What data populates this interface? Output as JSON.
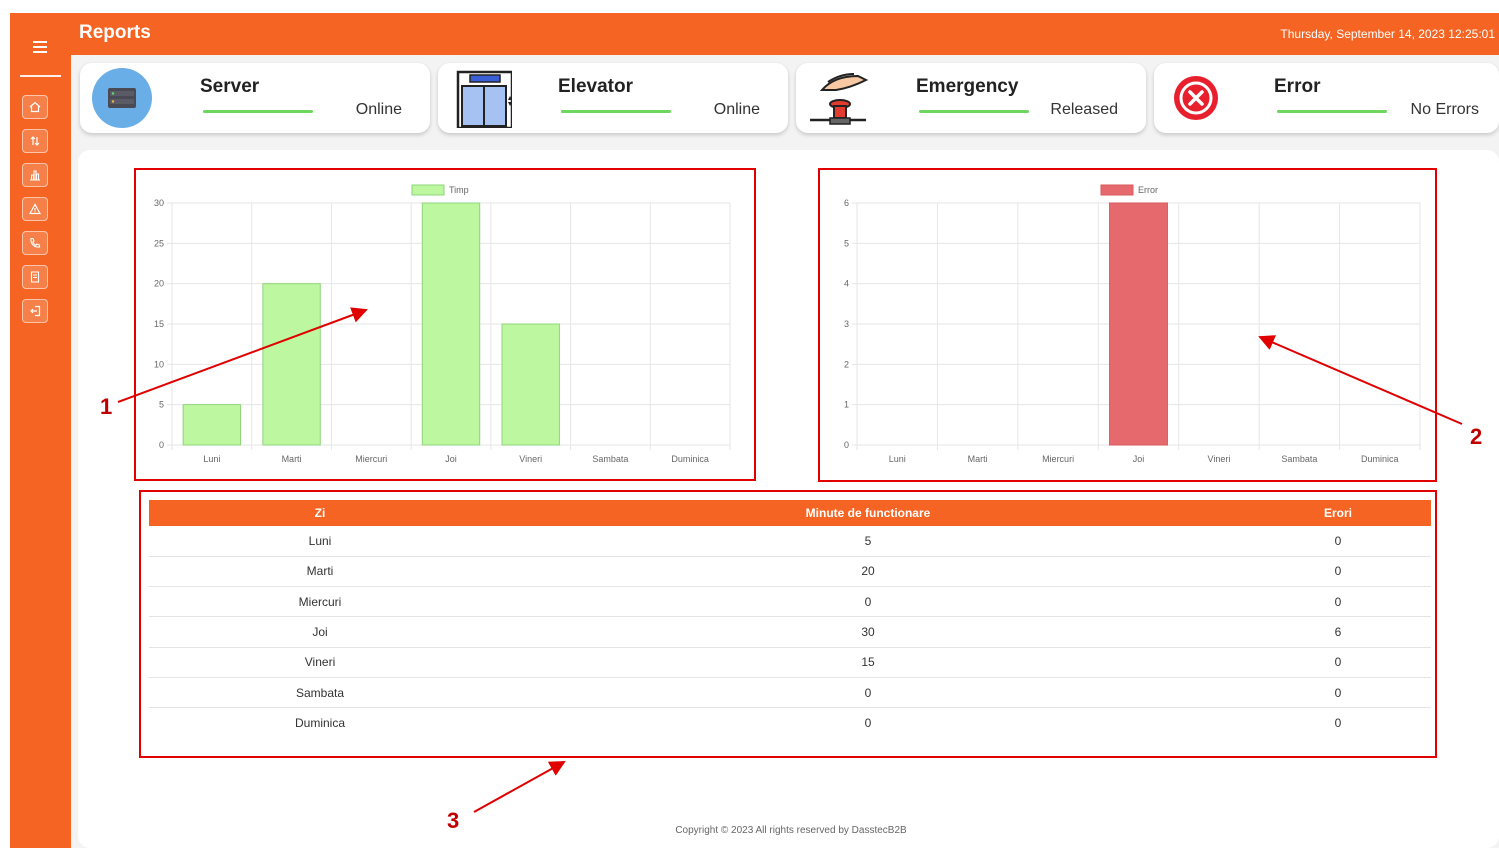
{
  "header": {
    "title": "Reports",
    "datetime": "Thursday, September 14, 2023  12:25:01"
  },
  "sidebar": {
    "items": [
      {
        "icon": "home-icon"
      },
      {
        "icon": "sort-arrows-icon"
      },
      {
        "icon": "bar-chart-icon"
      },
      {
        "icon": "warning-icon"
      },
      {
        "icon": "phone-icon"
      },
      {
        "icon": "document-icon"
      },
      {
        "icon": "logout-icon"
      }
    ]
  },
  "status_cards": [
    {
      "title": "Server",
      "status": "Online",
      "icon": "server-icon"
    },
    {
      "title": "Elevator",
      "status": "Online",
      "icon": "elevator-icon"
    },
    {
      "title": "Emergency",
      "status": "Released",
      "icon": "emergency-button-icon"
    },
    {
      "title": "Error",
      "status": "No Errors",
      "icon": "error-icon"
    }
  ],
  "colors": {
    "accent": "#f56423",
    "status_line": "#6cd65e",
    "chart1_bar": "#bdf8a0",
    "chart2_bar": "#e66a6d",
    "annotation": "#e00000"
  },
  "chart_data": [
    {
      "type": "bar",
      "categories": [
        "Luni",
        "Marti",
        "Miercuri",
        "Joi",
        "Vineri",
        "Sambata",
        "Duminica"
      ],
      "series": [
        {
          "name": "Timp",
          "values": [
            5,
            20,
            0,
            30,
            15,
            0,
            0
          ]
        }
      ],
      "ylim": [
        0,
        30
      ],
      "yticks": [
        "0",
        "5",
        "10",
        "15",
        "20",
        "25",
        "30"
      ],
      "grid": true,
      "legend": "top-center"
    },
    {
      "type": "bar",
      "categories": [
        "Luni",
        "Marti",
        "Miercuri",
        "Joi",
        "Vineri",
        "Sambata",
        "Duminica"
      ],
      "series": [
        {
          "name": "Error",
          "values": [
            0,
            0,
            0,
            6,
            0,
            0,
            0
          ]
        }
      ],
      "ylim": [
        0,
        6
      ],
      "yticks": [
        "0",
        "1",
        "2",
        "3",
        "4",
        "5",
        "6"
      ],
      "grid": true,
      "legend": "top-center"
    }
  ],
  "table": {
    "headers": [
      "Zi",
      "Minute de functionare",
      "Erori"
    ],
    "rows": [
      [
        "Luni",
        "5",
        "0"
      ],
      [
        "Marti",
        "20",
        "0"
      ],
      [
        "Miercuri",
        "0",
        "0"
      ],
      [
        "Joi",
        "30",
        "6"
      ],
      [
        "Vineri",
        "15",
        "0"
      ],
      [
        "Sambata",
        "0",
        "0"
      ],
      [
        "Duminica",
        "0",
        "0"
      ]
    ]
  },
  "footer": {
    "text": "Copyright © 2023 All rights reserved by DasstecB2B"
  },
  "annotations": [
    "1",
    "2",
    "3"
  ]
}
